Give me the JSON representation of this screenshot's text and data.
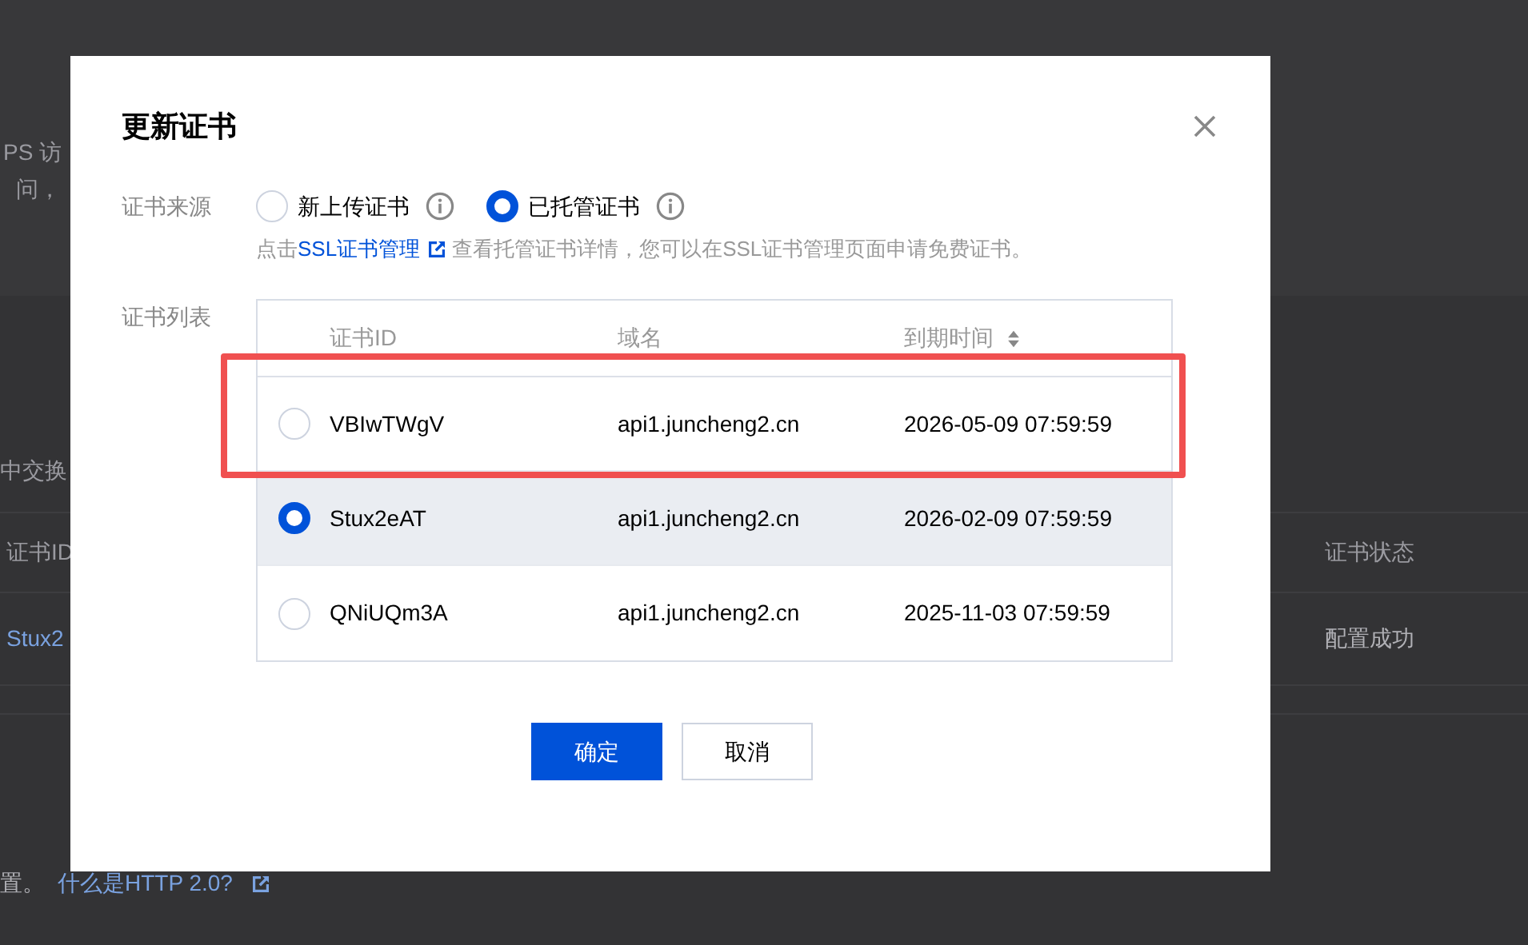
{
  "background": {
    "intro_lines": [
      "PS 访",
      "问，"
    ],
    "section_label": "中交换",
    "table": {
      "columns": [
        "证书ID",
        "证书状态"
      ],
      "row": [
        "Stux2",
        "配置成功"
      ]
    },
    "footer": {
      "text": "置。",
      "link": "什么是HTTP 2.0?"
    }
  },
  "dialog": {
    "title": "更新证书",
    "source": {
      "label": "证书来源",
      "options": [
        {
          "label": "新上传证书",
          "selected": false
        },
        {
          "label": "已托管证书",
          "selected": true
        }
      ],
      "hint": {
        "before": "点击",
        "link": "SSL证书管理",
        "after": "查看托管证书详情，您可以在SSL证书管理页面申请免费证书。"
      }
    },
    "list": {
      "label": "证书列表",
      "columns": [
        {
          "label": "证书ID",
          "sortable": false
        },
        {
          "label": "域名",
          "sortable": false
        },
        {
          "label": "到期时间",
          "sortable": true
        }
      ],
      "rows": [
        {
          "id": "VBIwTWgV",
          "domain": "api1.juncheng2.cn",
          "expires": "2026-05-09 07:59:59",
          "selected": false,
          "annotated": true
        },
        {
          "id": "Stux2eAT",
          "domain": "api1.juncheng2.cn",
          "expires": "2026-02-09 07:59:59",
          "selected": true,
          "annotated": false
        },
        {
          "id": "QNiUQm3A",
          "domain": "api1.juncheng2.cn",
          "expires": "2025-11-03 07:59:59",
          "selected": false,
          "annotated": false
        }
      ]
    },
    "buttons": [
      {
        "label": "确定",
        "kind": "primary"
      },
      {
        "label": "取消",
        "kind": "default"
      }
    ]
  }
}
